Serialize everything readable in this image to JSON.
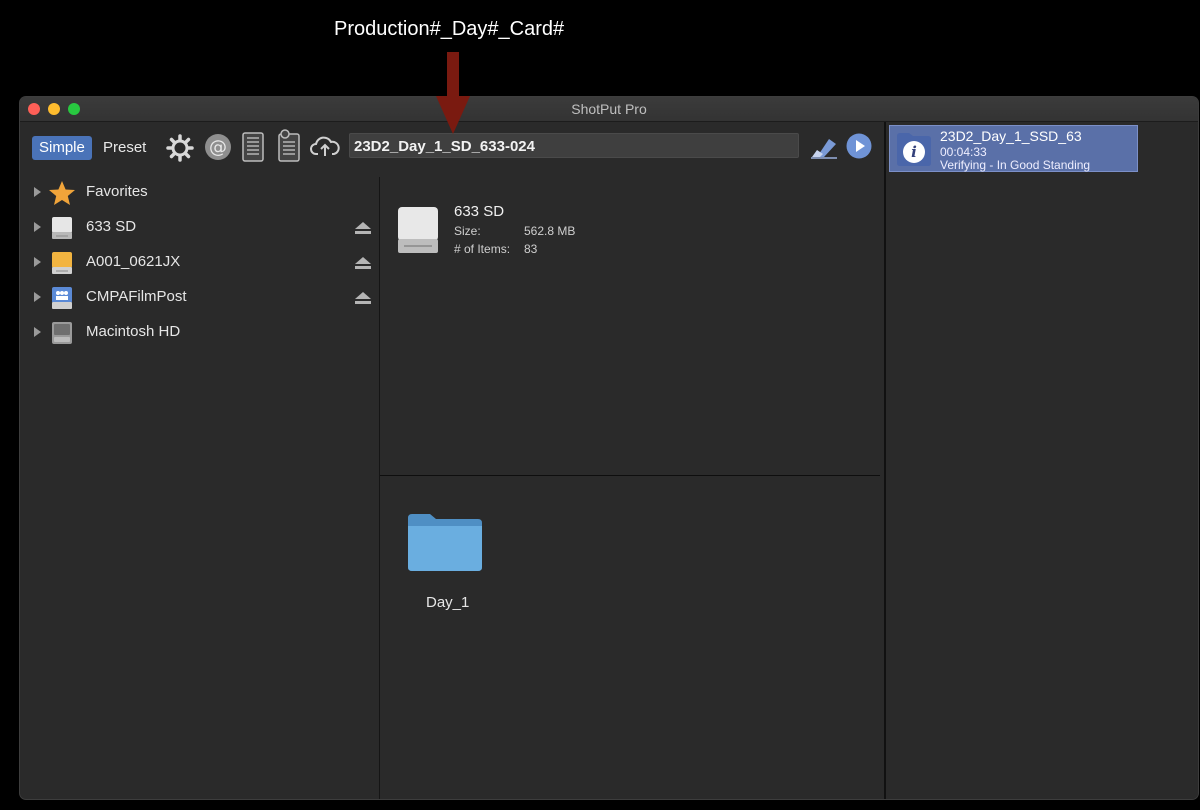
{
  "annotation": {
    "label": "Production#_Day#_Card#",
    "arrow_color": "#7a1a10"
  },
  "window": {
    "title": "ShotPut Pro"
  },
  "toolbar": {
    "simple_label": "Simple",
    "preset_label": "Preset",
    "icons": [
      "gear-icon",
      "at-sign-icon",
      "list-document-icon",
      "clipboard-icon",
      "cloud-upload-icon",
      "eraser-icon",
      "play-icon"
    ],
    "name_value": "23D2_Day_1_SD_633-024"
  },
  "sidebar": {
    "items": [
      {
        "label": "Favorites",
        "icon": "star-icon",
        "eject": false
      },
      {
        "label": "633 SD",
        "icon": "drive-icon",
        "eject": true
      },
      {
        "label": "A001_0621JX",
        "icon": "drive-orange-icon",
        "eject": true
      },
      {
        "label": "CMPAFilmPost",
        "icon": "network-drive-icon",
        "eject": true
      },
      {
        "label": "Macintosh HD",
        "icon": "hard-disk-icon",
        "eject": false
      }
    ]
  },
  "info": {
    "name": "633 SD",
    "size_label": "Size:",
    "size_value": "562.8 MB",
    "items_label": "# of Items:",
    "items_value": "83"
  },
  "files": {
    "folder_label": "Day_1"
  },
  "queue": {
    "title": "23D2_Day_1_SSD_63",
    "time": "00:04:33",
    "status": "Verifying - In Good Standing"
  },
  "colors": {
    "accent": "#4a73b8",
    "queue_bg": "#5a70a8",
    "window_bg": "#2a2a2a"
  }
}
